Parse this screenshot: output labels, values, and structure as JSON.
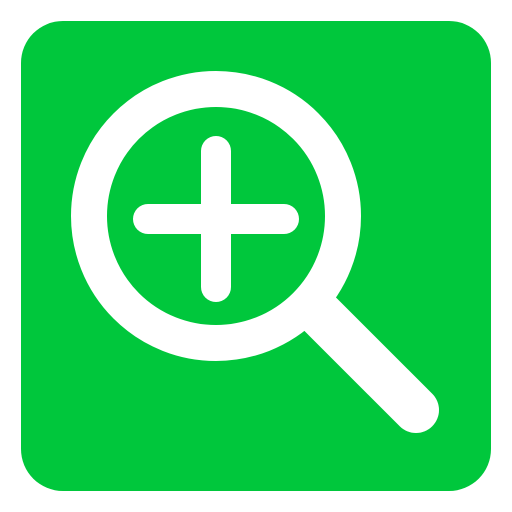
{
  "icon": {
    "name": "zoom-in-icon",
    "background_color": "#00c73c",
    "foreground_color": "#ffffff",
    "parts": [
      "magnifier-lens-icon",
      "magnifier-handle-icon",
      "plus-icon"
    ]
  }
}
